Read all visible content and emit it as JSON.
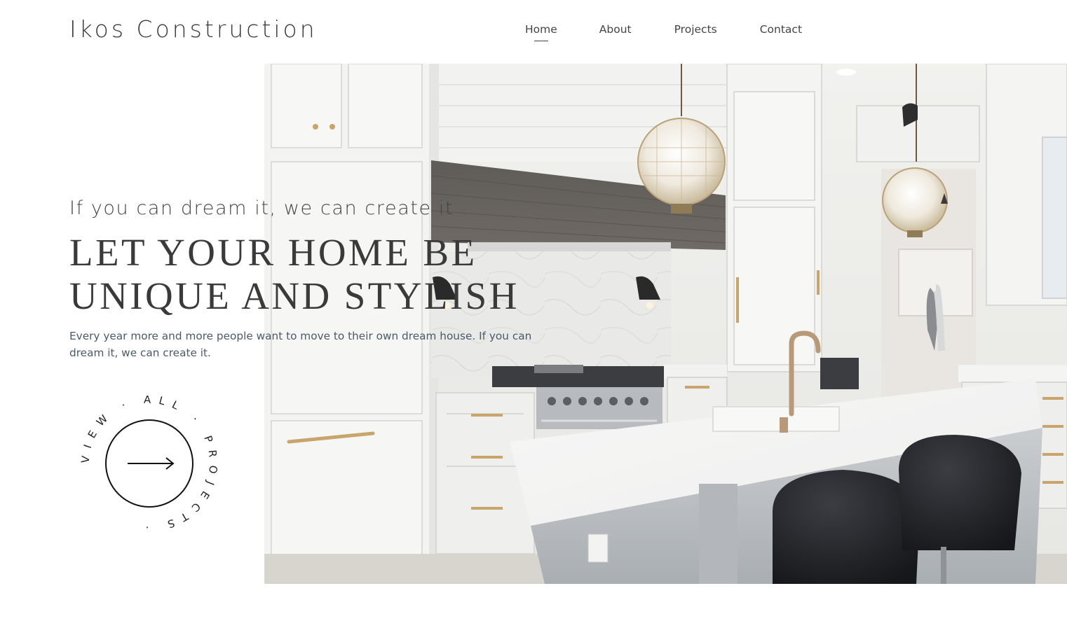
{
  "header": {
    "brand": "Ikos Construction",
    "nav": [
      {
        "label": "Home",
        "active": true
      },
      {
        "label": "About",
        "active": false
      },
      {
        "label": "Projects",
        "active": false
      },
      {
        "label": "Contact",
        "active": false
      }
    ]
  },
  "hero": {
    "tagline": "If you can dream it, we can create it",
    "headline_line1": "LET YOUR HOME BE",
    "headline_line2": "UNIQUE AND STYLISH",
    "description": "Every year more and more people want to move to their own dream house. If you can dream it, we can create it.",
    "image_subject": "white kitchen interior with island, crystal pendant lights and black bar stools",
    "cta": {
      "ring_text": "VIEW · ALL · PROJECTS ·",
      "icon": "arrow-right-icon"
    }
  },
  "colors": {
    "text_dark": "#3a3a3a",
    "text_body": "#4b5a6b",
    "background": "#ffffff"
  }
}
